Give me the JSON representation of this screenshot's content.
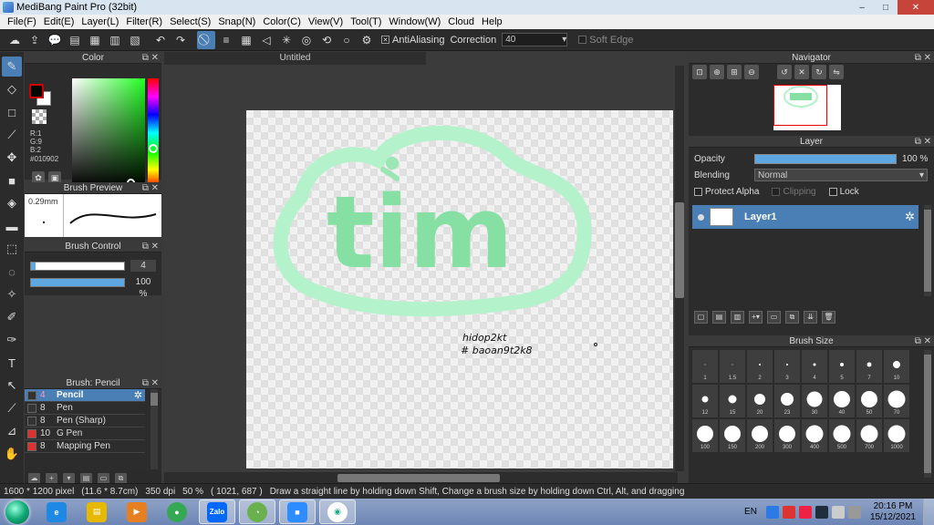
{
  "window": {
    "title": "MediBang Paint Pro (32bit)",
    "minimize": "–",
    "maximize": "□",
    "close": "✕"
  },
  "menu": [
    "File(F)",
    "Edit(E)",
    "Layer(L)",
    "Filter(R)",
    "Select(S)",
    "Snap(N)",
    "Color(C)",
    "View(V)",
    "Tool(T)",
    "Window(W)",
    "Cloud",
    "Help"
  ],
  "toolbar": {
    "antialiasing_label": "AntiAliasing",
    "antialiasing_checked": true,
    "correction_label": "Correction",
    "correction_value": "40",
    "soft_edge_label": "Soft Edge",
    "soft_edge_checked": false
  },
  "color_panel": {
    "title": "Color",
    "r": "R:1",
    "g": "G:9",
    "b": "B:2",
    "hex": "#010902",
    "foreground": "#010902",
    "background": "#ffffff"
  },
  "brush_preview": {
    "title": "Brush Preview",
    "size": "0.29mm"
  },
  "brush_control": {
    "title": "Brush Control",
    "size_value": "4",
    "opacity_value": "100 %"
  },
  "brush_list": {
    "title": "Brush: Pencil",
    "items": [
      {
        "size": "4",
        "name": "Pencil",
        "color": "#333333",
        "active": true
      },
      {
        "size": "8",
        "name": "Pen",
        "color": "#333333",
        "active": false
      },
      {
        "size": "8",
        "name": "Pen (Sharp)",
        "color": "#333333",
        "active": false
      },
      {
        "size": "10",
        "name": "G Pen",
        "color": "#e03030",
        "active": false
      },
      {
        "size": "8",
        "name": "Mapping Pen",
        "color": "#e03030",
        "active": false
      }
    ]
  },
  "document": {
    "tab_title": "Untitled",
    "drawing_text": "tim",
    "handwriting_line1": "hidop2kt",
    "handwriting_line2": "# baoan9t2k8"
  },
  "navigator": {
    "title": "Navigator"
  },
  "layer_panel": {
    "title": "Layer",
    "opacity_label": "Opacity",
    "opacity_value": "100 %",
    "blending_label": "Blending",
    "blending_value": "Normal",
    "protect_alpha_label": "Protect Alpha",
    "clipping_label": "Clipping",
    "lock_label": "Lock",
    "layers": [
      {
        "name": "Layer1"
      }
    ]
  },
  "brush_size_panel": {
    "title": "Brush Size",
    "sizes": [
      "1",
      "1.5",
      "2",
      "3",
      "4",
      "5",
      "7",
      "10",
      "12",
      "15",
      "20",
      "23",
      "30",
      "40",
      "50",
      "70",
      "100",
      "150",
      "200",
      "300",
      "400",
      "500",
      "700",
      "1000"
    ]
  },
  "status": {
    "dimensions": "1600 * 1200 pixel",
    "physical": "(11.6 * 8.7cm)",
    "dpi": "350 dpi",
    "zoom": "50 %",
    "coords": "( 1021, 687 )",
    "hint": "Draw a straight line by holding down Shift, Change a brush size by holding down Ctrl, Alt, and dragging"
  },
  "taskbar": {
    "language": "EN",
    "time": "20:16 PM",
    "date": "15/12/2021",
    "apps": [
      {
        "name": "internet-explorer",
        "label": "e",
        "color": "#1e88e5"
      },
      {
        "name": "file-explorer",
        "label": "▤",
        "color": "#e6b800"
      },
      {
        "name": "media-player",
        "label": "▶",
        "color": "#e67e22"
      },
      {
        "name": "chrome",
        "label": "●",
        "color": "#34a853"
      },
      {
        "name": "zalo",
        "label": "Zalo",
        "color": "#0068ff"
      },
      {
        "name": "greenshot",
        "label": "◔",
        "color": "#6ab04c"
      },
      {
        "name": "zoom",
        "label": "■",
        "color": "#2d8cff"
      },
      {
        "name": "medibang",
        "label": "◉",
        "color": "#ffffff"
      }
    ]
  },
  "colors": {
    "accent": "#4a7fb5",
    "panel": "#2c2c2c",
    "drawing_mint": "#aef0c4",
    "drawing_green": "#7fe0a0"
  }
}
